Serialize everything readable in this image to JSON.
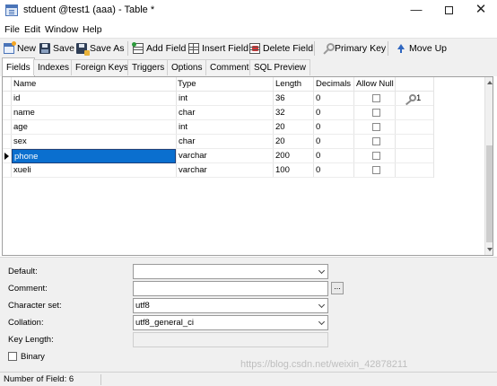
{
  "window": {
    "title": "stduent @test1 (aaa) - Table *",
    "controls": {
      "minimize": "—",
      "close": "✕"
    }
  },
  "menu": [
    "File",
    "Edit",
    "Window",
    "Help"
  ],
  "toolbar": {
    "new": "New",
    "save": "Save",
    "save_as": "Save As",
    "add_field": "Add Field",
    "insert_field": "Insert Field",
    "delete_field": "Delete Field",
    "primary_key": "Primary Key",
    "move_up": "Move Up"
  },
  "tabs": [
    "Fields",
    "Indexes",
    "Foreign Keys",
    "Triggers",
    "Options",
    "Comment",
    "SQL Preview"
  ],
  "active_tab": "Fields",
  "grid": {
    "columns": [
      "Name",
      "Type",
      "Length",
      "Decimals",
      "Allow Null",
      ""
    ],
    "rows": [
      {
        "name": "id",
        "type": "int",
        "length": "36",
        "decimals": "0",
        "allow_null": false,
        "key": "1"
      },
      {
        "name": "name",
        "type": "char",
        "length": "32",
        "decimals": "0",
        "allow_null": false,
        "key": ""
      },
      {
        "name": "age",
        "type": "int",
        "length": "20",
        "decimals": "0",
        "allow_null": false,
        "key": ""
      },
      {
        "name": "sex",
        "type": "char",
        "length": "20",
        "decimals": "0",
        "allow_null": false,
        "key": ""
      },
      {
        "name": "phone",
        "type": "varchar",
        "length": "200",
        "decimals": "0",
        "allow_null": false,
        "key": ""
      },
      {
        "name": "xueli",
        "type": "varchar",
        "length": "100",
        "decimals": "0",
        "allow_null": false,
        "key": ""
      }
    ],
    "selected_row": "phone"
  },
  "properties": {
    "default_label": "Default:",
    "default_value": "",
    "comment_label": "Comment:",
    "comment_value": "",
    "comment_button": "...",
    "charset_label": "Character set:",
    "charset_value": "utf8",
    "collation_label": "Collation:",
    "collation_value": "utf8_general_ci",
    "key_length_label": "Key Length:",
    "key_length_value": "",
    "binary_label": "Binary",
    "binary_checked": false
  },
  "status": {
    "text": "Number of Field: 6",
    "watermark": "https://blog.csdn.net/weixin_42878211"
  },
  "colors": {
    "selection": "#0a6fcf",
    "chrome": "#f0f0f0",
    "grid_border": "#a0a0a0"
  },
  "icons": {
    "new": "new-table-icon",
    "save": "save-icon",
    "save_as": "save-as-icon",
    "add_field": "add-field-icon",
    "insert_field": "insert-field-icon",
    "delete_field": "delete-field-icon",
    "primary_key": "key-icon",
    "move_up": "arrow-up-icon"
  }
}
